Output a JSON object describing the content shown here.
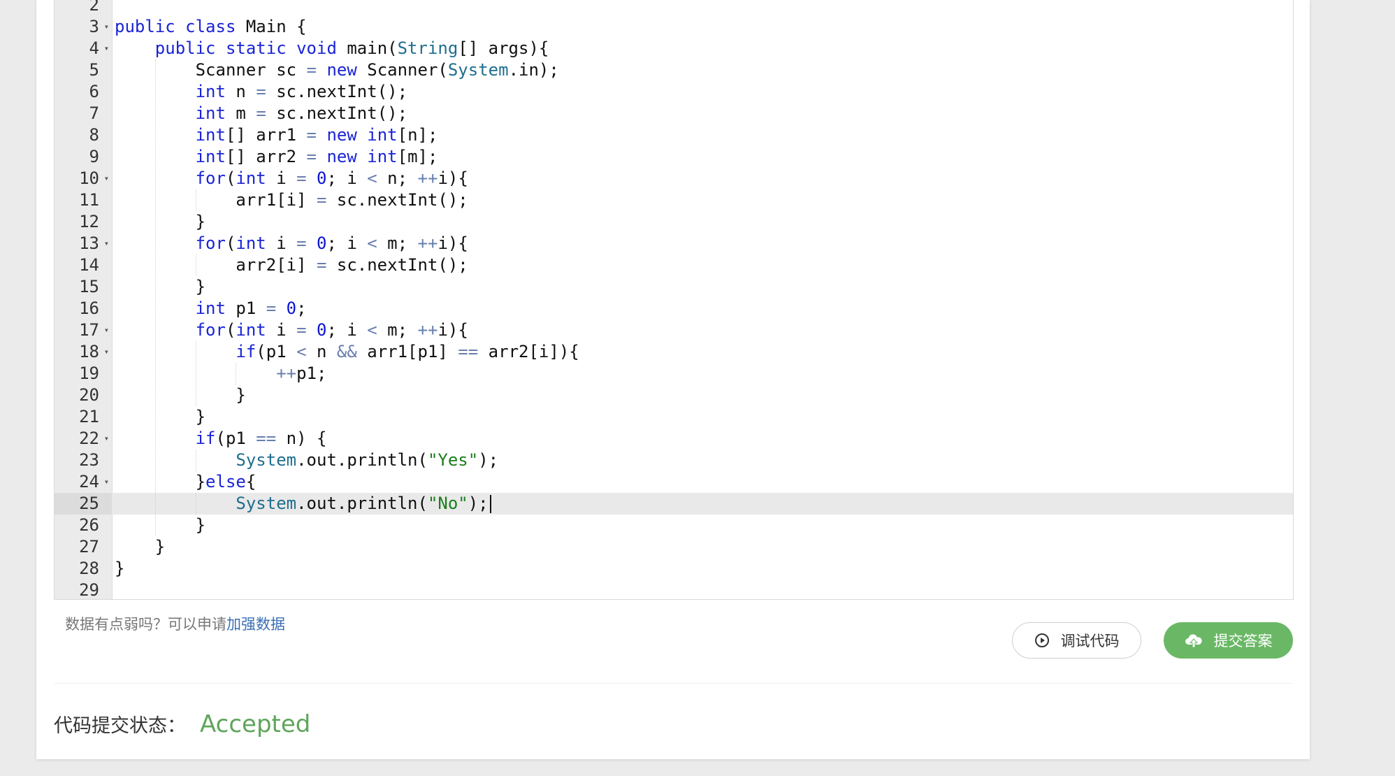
{
  "editor": {
    "active_line": 25,
    "lines": [
      {
        "n": 2,
        "fold": false,
        "indent": 0,
        "tokens": []
      },
      {
        "n": 3,
        "fold": true,
        "indent": 0,
        "tokens": [
          [
            "kw",
            "public"
          ],
          [
            "t",
            " "
          ],
          [
            "kw",
            "class"
          ],
          [
            "t",
            " Main {"
          ]
        ]
      },
      {
        "n": 4,
        "fold": true,
        "indent": 1,
        "tokens": [
          [
            "kw",
            "public"
          ],
          [
            "t",
            " "
          ],
          [
            "kw",
            "static"
          ],
          [
            "t",
            " "
          ],
          [
            "kw",
            "void"
          ],
          [
            "t",
            " main("
          ],
          [
            "cls",
            "String"
          ],
          [
            "t",
            "[] args){"
          ]
        ]
      },
      {
        "n": 5,
        "fold": false,
        "indent": 2,
        "tokens": [
          [
            "t",
            "Scanner sc "
          ],
          [
            "op",
            "="
          ],
          [
            "t",
            " "
          ],
          [
            "kw",
            "new"
          ],
          [
            "t",
            " Scanner("
          ],
          [
            "cls",
            "System"
          ],
          [
            "t",
            ".in);"
          ]
        ]
      },
      {
        "n": 6,
        "fold": false,
        "indent": 2,
        "tokens": [
          [
            "kw",
            "int"
          ],
          [
            "t",
            " n "
          ],
          [
            "op",
            "="
          ],
          [
            "t",
            " sc.nextInt();"
          ]
        ]
      },
      {
        "n": 7,
        "fold": false,
        "indent": 2,
        "tokens": [
          [
            "kw",
            "int"
          ],
          [
            "t",
            " m "
          ],
          [
            "op",
            "="
          ],
          [
            "t",
            " sc.nextInt();"
          ]
        ]
      },
      {
        "n": 8,
        "fold": false,
        "indent": 2,
        "tokens": [
          [
            "kw",
            "int"
          ],
          [
            "t",
            "[] arr1 "
          ],
          [
            "op",
            "="
          ],
          [
            "t",
            " "
          ],
          [
            "kw",
            "new"
          ],
          [
            "t",
            " "
          ],
          [
            "kw",
            "int"
          ],
          [
            "t",
            "[n];"
          ]
        ]
      },
      {
        "n": 9,
        "fold": false,
        "indent": 2,
        "tokens": [
          [
            "kw",
            "int"
          ],
          [
            "t",
            "[] arr2 "
          ],
          [
            "op",
            "="
          ],
          [
            "t",
            " "
          ],
          [
            "kw",
            "new"
          ],
          [
            "t",
            " "
          ],
          [
            "kw",
            "int"
          ],
          [
            "t",
            "[m];"
          ]
        ]
      },
      {
        "n": 10,
        "fold": true,
        "indent": 2,
        "tokens": [
          [
            "kw",
            "for"
          ],
          [
            "t",
            "("
          ],
          [
            "kw",
            "int"
          ],
          [
            "t",
            " i "
          ],
          [
            "op",
            "="
          ],
          [
            "t",
            " "
          ],
          [
            "num",
            "0"
          ],
          [
            "t",
            "; i "
          ],
          [
            "op",
            "<"
          ],
          [
            "t",
            " n; "
          ],
          [
            "op",
            "++"
          ],
          [
            "t",
            "i){"
          ]
        ]
      },
      {
        "n": 11,
        "fold": false,
        "indent": 3,
        "tokens": [
          [
            "t",
            "arr1[i] "
          ],
          [
            "op",
            "="
          ],
          [
            "t",
            " sc.nextInt();"
          ]
        ]
      },
      {
        "n": 12,
        "fold": false,
        "indent": 2,
        "tokens": [
          [
            "t",
            "}"
          ]
        ]
      },
      {
        "n": 13,
        "fold": true,
        "indent": 2,
        "tokens": [
          [
            "kw",
            "for"
          ],
          [
            "t",
            "("
          ],
          [
            "kw",
            "int"
          ],
          [
            "t",
            " i "
          ],
          [
            "op",
            "="
          ],
          [
            "t",
            " "
          ],
          [
            "num",
            "0"
          ],
          [
            "t",
            "; i "
          ],
          [
            "op",
            "<"
          ],
          [
            "t",
            " m; "
          ],
          [
            "op",
            "++"
          ],
          [
            "t",
            "i){"
          ]
        ]
      },
      {
        "n": 14,
        "fold": false,
        "indent": 3,
        "tokens": [
          [
            "t",
            "arr2[i] "
          ],
          [
            "op",
            "="
          ],
          [
            "t",
            " sc.nextInt();"
          ]
        ]
      },
      {
        "n": 15,
        "fold": false,
        "indent": 2,
        "tokens": [
          [
            "t",
            "}"
          ]
        ]
      },
      {
        "n": 16,
        "fold": false,
        "indent": 2,
        "tokens": [
          [
            "kw",
            "int"
          ],
          [
            "t",
            " p1 "
          ],
          [
            "op",
            "="
          ],
          [
            "t",
            " "
          ],
          [
            "num",
            "0"
          ],
          [
            "t",
            ";"
          ]
        ]
      },
      {
        "n": 17,
        "fold": true,
        "indent": 2,
        "tokens": [
          [
            "kw",
            "for"
          ],
          [
            "t",
            "("
          ],
          [
            "kw",
            "int"
          ],
          [
            "t",
            " i "
          ],
          [
            "op",
            "="
          ],
          [
            "t",
            " "
          ],
          [
            "num",
            "0"
          ],
          [
            "t",
            "; i "
          ],
          [
            "op",
            "<"
          ],
          [
            "t",
            " m; "
          ],
          [
            "op",
            "++"
          ],
          [
            "t",
            "i){"
          ]
        ]
      },
      {
        "n": 18,
        "fold": true,
        "indent": 3,
        "tokens": [
          [
            "kw",
            "if"
          ],
          [
            "t",
            "(p1 "
          ],
          [
            "op",
            "<"
          ],
          [
            "t",
            " n "
          ],
          [
            "op",
            "&&"
          ],
          [
            "t",
            " arr1[p1] "
          ],
          [
            "op",
            "=="
          ],
          [
            "t",
            " arr2[i]){"
          ]
        ]
      },
      {
        "n": 19,
        "fold": false,
        "indent": 4,
        "tokens": [
          [
            "op",
            "++"
          ],
          [
            "t",
            "p1;"
          ]
        ]
      },
      {
        "n": 20,
        "fold": false,
        "indent": 3,
        "tokens": [
          [
            "t",
            "}"
          ]
        ]
      },
      {
        "n": 21,
        "fold": false,
        "indent": 2,
        "tokens": [
          [
            "t",
            "}"
          ]
        ]
      },
      {
        "n": 22,
        "fold": true,
        "indent": 2,
        "tokens": [
          [
            "kw",
            "if"
          ],
          [
            "t",
            "(p1 "
          ],
          [
            "op",
            "=="
          ],
          [
            "t",
            " n) {"
          ]
        ]
      },
      {
        "n": 23,
        "fold": false,
        "indent": 3,
        "tokens": [
          [
            "cls",
            "System"
          ],
          [
            "t",
            ".out.println("
          ],
          [
            "str",
            "\"Yes\""
          ],
          [
            "t",
            ");"
          ]
        ]
      },
      {
        "n": 24,
        "fold": true,
        "indent": 2,
        "tokens": [
          [
            "t",
            "}"
          ],
          [
            "kw",
            "else"
          ],
          [
            "t",
            "{"
          ]
        ]
      },
      {
        "n": 25,
        "fold": false,
        "indent": 3,
        "tokens": [
          [
            "cls",
            "System"
          ],
          [
            "t",
            ".out.println("
          ],
          [
            "str",
            "\"No\""
          ],
          [
            "t",
            ");"
          ]
        ]
      },
      {
        "n": 26,
        "fold": false,
        "indent": 2,
        "tokens": [
          [
            "t",
            "}"
          ]
        ]
      },
      {
        "n": 27,
        "fold": false,
        "indent": 1,
        "tokens": [
          [
            "t",
            "}"
          ]
        ]
      },
      {
        "n": 28,
        "fold": false,
        "indent": 0,
        "tokens": [
          [
            "t",
            "}"
          ]
        ]
      },
      {
        "n": 29,
        "fold": false,
        "indent": 0,
        "tokens": []
      }
    ]
  },
  "hint": {
    "text": "数据有点弱吗？可以申请",
    "link": "加强数据"
  },
  "buttons": {
    "debug_label": "调试代码",
    "debug_icon": "play-circle-icon",
    "submit_label": "提交答案",
    "submit_icon": "cloud-upload-icon"
  },
  "status": {
    "label": "代码提交状态：",
    "value": "Accepted"
  },
  "colors": {
    "keyword": "#1a24d6",
    "class_name": "#1f6e8f",
    "string": "#1b7d1b",
    "number": "#0c14d0",
    "operator": "#677fae",
    "submit_button": "#6ab865",
    "accepted": "#5ea55a",
    "link": "#3a6fb5"
  }
}
